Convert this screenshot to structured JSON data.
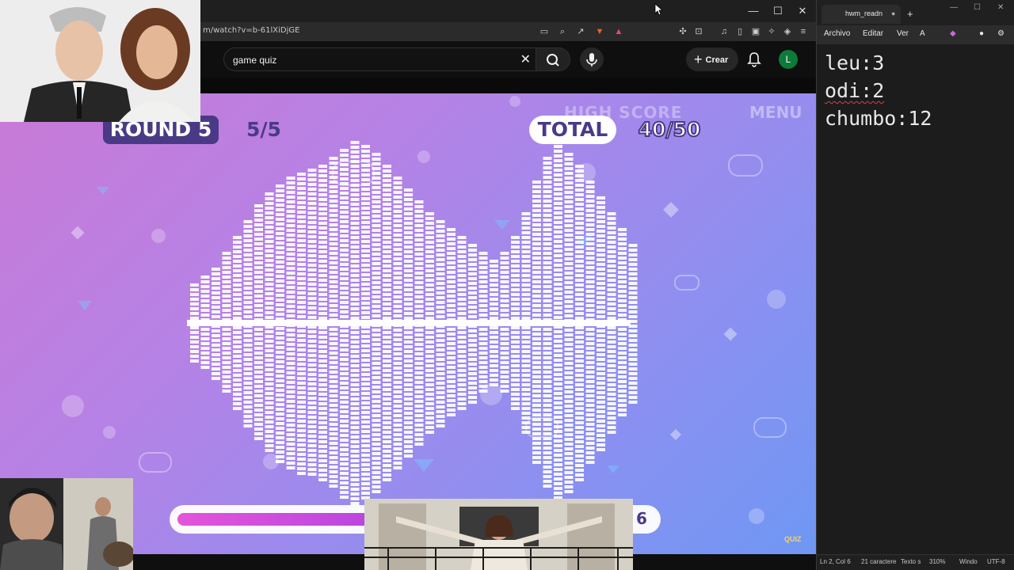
{
  "browser": {
    "url": "m/watch?v=b-61lXiDjGE",
    "window_controls": [
      "—",
      "☐",
      "✕"
    ]
  },
  "youtube": {
    "search_value": "game quiz",
    "create_label": "Crear",
    "avatar_letter": "L"
  },
  "game": {
    "round_label": "ROUND 5",
    "round_progress": "5/5",
    "total_label": "TOTAL",
    "total_score": "40/50",
    "high_score_label": "HIGH SCORE",
    "menu_label": "MENU",
    "timer": "6",
    "timer_fill_fraction": 0.42,
    "logo": "QUIZ"
  },
  "notepad": {
    "tab_title": "hwm_readn",
    "menu": [
      "Archivo",
      "Editar",
      "Ver"
    ],
    "lines": [
      "leu:3",
      "odi:2",
      "chumbo:12"
    ],
    "status": {
      "position": "Ln 2, Col 6",
      "chars": "21 caractere",
      "format": "Texto s",
      "zoom": "310%",
      "eol": "Windo",
      "encoding": "UTF-8"
    }
  },
  "colors": {
    "stage_start": "#c97ad6",
    "stage_end": "#6f97f4",
    "accent_purple": "#4a3a86",
    "progress_pink": "#e454d9"
  }
}
